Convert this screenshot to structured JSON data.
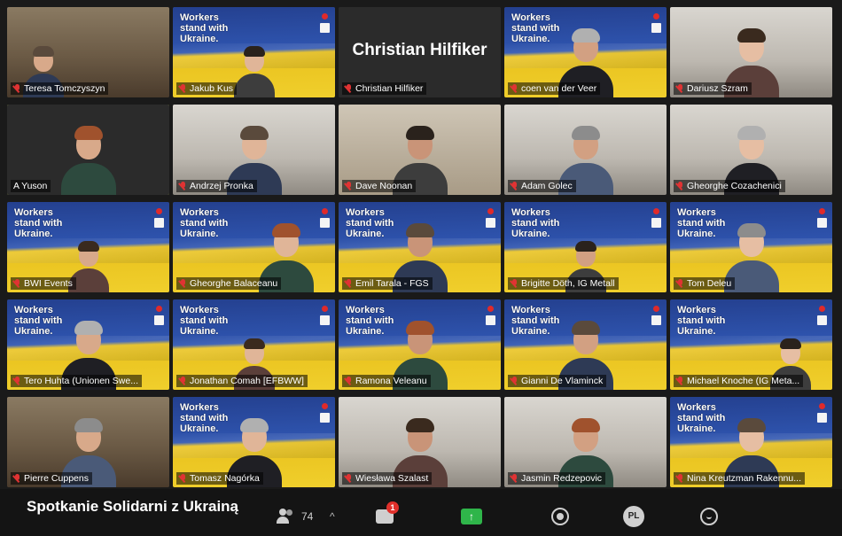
{
  "meeting": {
    "title": "Spotkanie Solidarni z Ukrainą"
  },
  "banner_text": "Workers\nstand with\nUkraine.",
  "participants": [
    {
      "name": "Teresa Tomczyszyn",
      "bg": "home"
    },
    {
      "name": "Jakub Kus",
      "bg": "ua"
    },
    {
      "name": "Christian Hilfiker",
      "bg": "dark",
      "video_off": true
    },
    {
      "name": "coen van der Veer",
      "bg": "ua"
    },
    {
      "name": "Dariusz Szram",
      "bg": "office"
    },
    {
      "name": "A Yuson",
      "bg": "dark",
      "active_speaker": true
    },
    {
      "name": "Andrzej Pronka",
      "bg": "office"
    },
    {
      "name": "Dave Noonan",
      "bg": "room"
    },
    {
      "name": "Adam Golec",
      "bg": "office"
    },
    {
      "name": "Gheorghe Cozachenici",
      "bg": "office"
    },
    {
      "name": "BWI Events",
      "bg": "ua"
    },
    {
      "name": "Gheorghe Balaceanu",
      "bg": "ua"
    },
    {
      "name": "Emil Tarala - FGS",
      "bg": "ua"
    },
    {
      "name": "Brigitte Döth, IG Metall",
      "bg": "ua"
    },
    {
      "name": "Tom Deleu",
      "bg": "ua"
    },
    {
      "name": "Tero Huhta (Unionen Swe...",
      "bg": "ua"
    },
    {
      "name": "Jonathan Comah [EFBWW]",
      "bg": "ua"
    },
    {
      "name": "Ramona Veleanu",
      "bg": "ua"
    },
    {
      "name": "Gianni De Vlaminck",
      "bg": "ua"
    },
    {
      "name": "Michael Knoche (IG Meta...",
      "bg": "ua"
    },
    {
      "name": "Pierre Cuppens",
      "bg": "home"
    },
    {
      "name": "Tomasz Nagórka",
      "bg": "ua"
    },
    {
      "name": "Wiesława Szalast",
      "bg": "office"
    },
    {
      "name": "Jasmin Redzepovic",
      "bg": "office"
    },
    {
      "name": "Nina Kreutzman Rakennu...",
      "bg": "ua"
    }
  ],
  "toolbar": {
    "participants_count": "74",
    "chat_badge": "1",
    "share_glyph": "↑",
    "avatar_initials": "PL",
    "caret": "^"
  },
  "colors": {
    "active_outline": "#c9d94a",
    "muted_mic": "#e03333",
    "share_green": "#2fb54a"
  },
  "icons": [
    "participants-icon",
    "chat-icon",
    "share-screen-icon",
    "record-icon",
    "avatar",
    "reactions-icon",
    "mic-muted-icon"
  ]
}
